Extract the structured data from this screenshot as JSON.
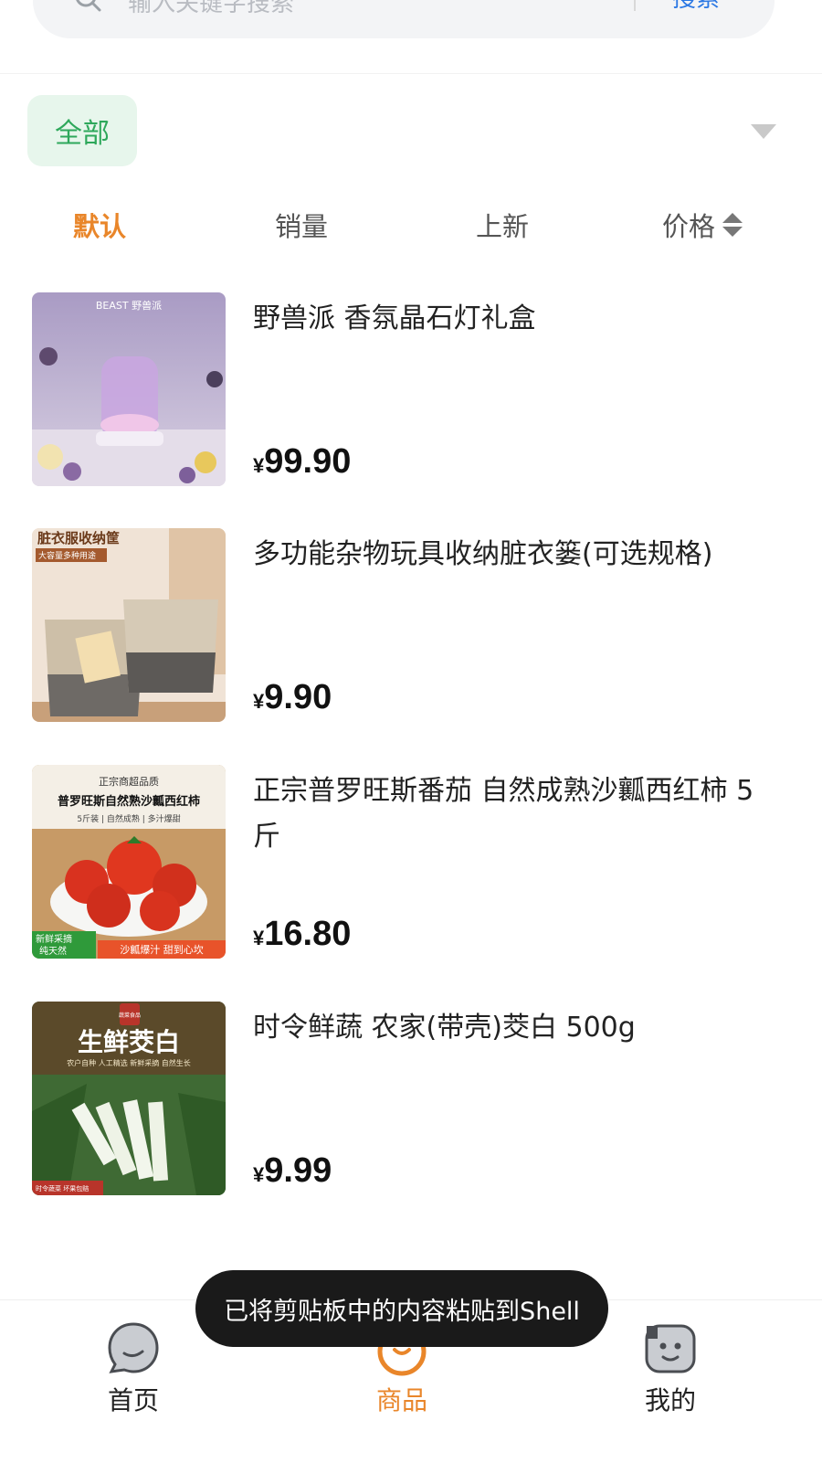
{
  "search": {
    "placeholder": "输入关键字搜索",
    "button_label": "搜索"
  },
  "category": {
    "selected": "全部"
  },
  "sort_tabs": [
    {
      "label": "默认",
      "active": true
    },
    {
      "label": "销量",
      "active": false
    },
    {
      "label": "上新",
      "active": false
    },
    {
      "label": "价格",
      "active": false
    }
  ],
  "products": [
    {
      "name": "野兽派 香氛晶石灯礼盒",
      "currency": "¥",
      "price": "99.90",
      "thumb_text": [
        "BEAST 野兽派"
      ]
    },
    {
      "name": "多功能杂物玩具收纳脏衣篓(可选规格)",
      "currency": "¥",
      "price": "9.90",
      "thumb_text": [
        "脏衣服收纳筐",
        "大容量多种用途"
      ]
    },
    {
      "name": "正宗普罗旺斯番茄 自然成熟沙瓤西红柿 5 斤",
      "currency": "¥",
      "price": "16.80",
      "thumb_text": [
        "正宗商超品质",
        "普罗旺斯自然熟沙瓤西红柿",
        "5斤装 | 自然成熟 | 多汁爆甜",
        "新鲜采摘",
        "纯天然",
        "沙瓤爆汁 甜到心坎"
      ]
    },
    {
      "name": "时令鲜蔬 农家(带壳)茭白 500g",
      "currency": "¥",
      "price": "9.99",
      "thumb_text": [
        "蔬菜食品",
        "生鲜茭白",
        "农户自种 人工精选 新鲜采摘 自然生长",
        "时令蔬菜 坏果包赔"
      ]
    }
  ],
  "bottom_nav": [
    {
      "label": "首页",
      "icon": "home-chat-icon",
      "active": false
    },
    {
      "label": "商品",
      "icon": "goods-icon",
      "active": true
    },
    {
      "label": "我的",
      "icon": "profile-face-icon",
      "active": false
    }
  ],
  "toast": {
    "message": "已将剪贴板中的内容粘贴到Shell"
  },
  "colors": {
    "accent": "#e9862a",
    "category_chip_bg": "#e7f6ec",
    "category_chip_text": "#2ea85b",
    "search_button": "#2b78e4",
    "toast_bg": "#1a1a1a"
  }
}
